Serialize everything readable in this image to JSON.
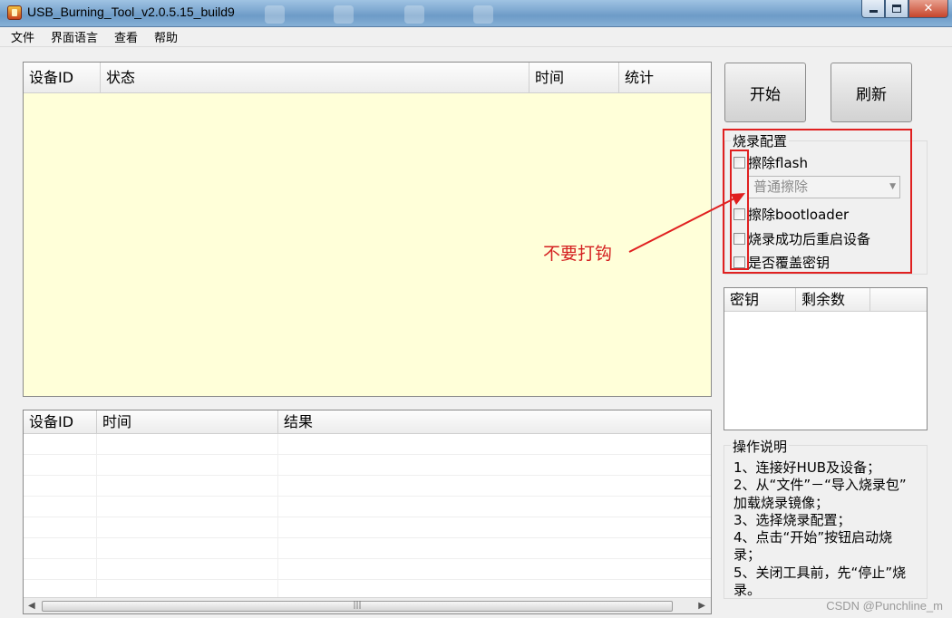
{
  "window": {
    "title": "USB_Burning_Tool_v2.0.5.15_build9"
  },
  "menu": [
    "文件",
    "界面语言",
    "查看",
    "帮助"
  ],
  "device_table": {
    "columns": [
      "设备ID",
      "状态",
      "时间",
      "统计"
    ]
  },
  "log_table": {
    "columns": [
      "设备ID",
      "时间",
      "结果"
    ]
  },
  "buttons": {
    "start": "开始",
    "refresh": "刷新"
  },
  "burn_config": {
    "title": "烧录配置",
    "erase_flash": {
      "label": "擦除flash",
      "checked": false
    },
    "erase_mode": {
      "value": "普通擦除"
    },
    "erase_bootloader": {
      "label": "擦除bootloader",
      "checked": false
    },
    "reboot_after_success": {
      "label": "烧录成功后重启设备",
      "checked": false
    },
    "overwrite_keys": {
      "label": "是否覆盖密钥",
      "checked": false
    }
  },
  "key_table": {
    "columns": [
      "密钥",
      "剩余数"
    ]
  },
  "instructions": {
    "title": "操作说明",
    "lines": [
      "1、连接好HUB及设备；",
      "2、从“文件”－“导入烧录包”",
      "加载烧录镜像；",
      "3、选择烧录配置；",
      "4、点击“开始”按钮启动烧",
      "录；",
      "5、关闭工具前，先“停止”烧",
      "录。"
    ]
  },
  "annotation": "不要打钩",
  "watermark": "CSDN @Punchline_m",
  "colors": {
    "highlight_red": "#e02020",
    "table_bg": "#ffffd9"
  }
}
